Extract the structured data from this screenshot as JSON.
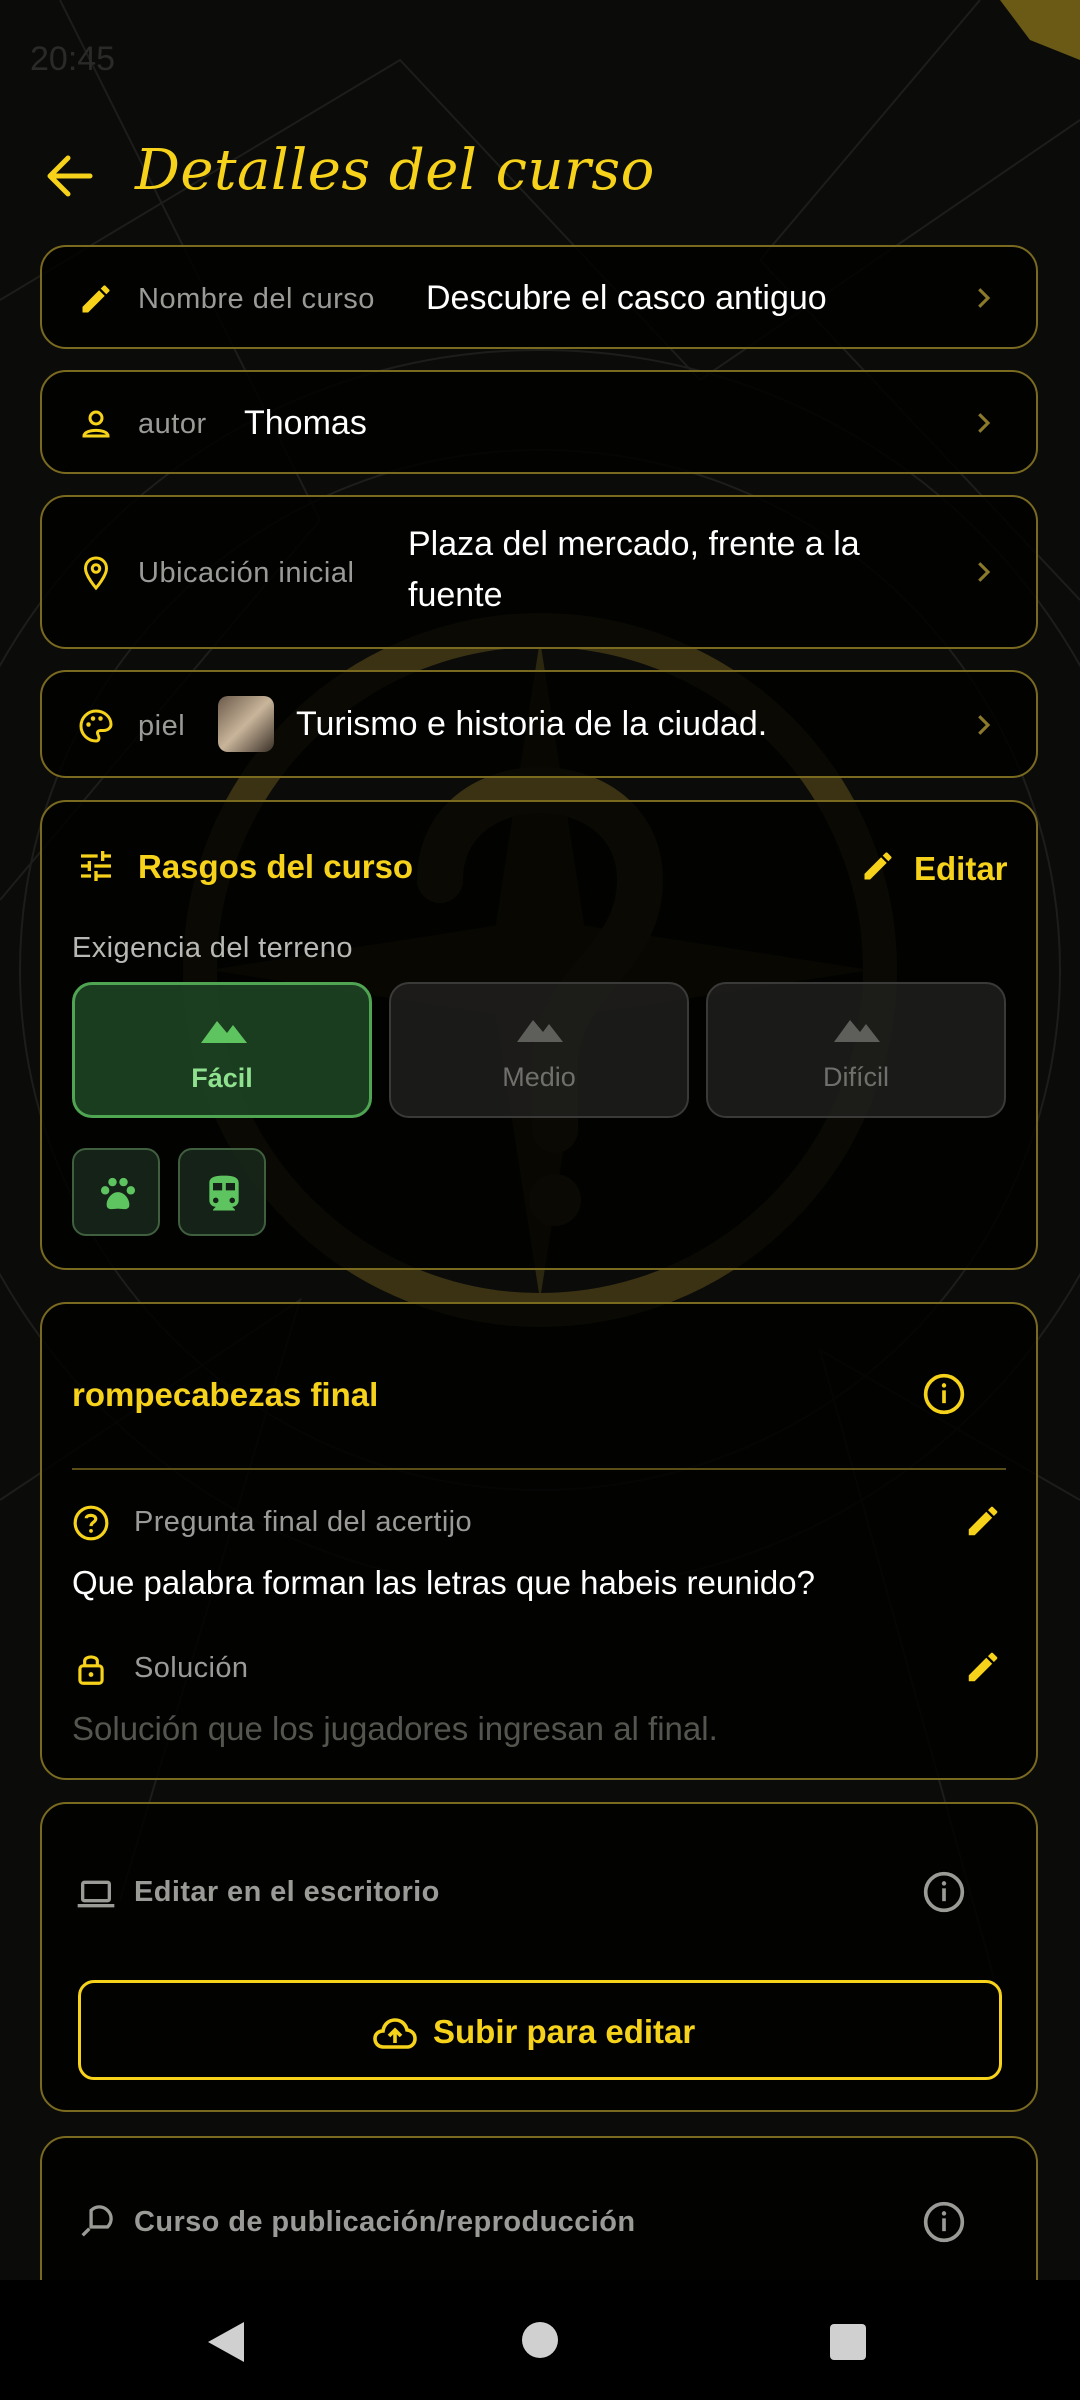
{
  "status_bar": {
    "time": "20:45"
  },
  "header": {
    "title": "Detalles del curso"
  },
  "rows": {
    "name": {
      "label": "Nombre del curso",
      "value": "Descubre el casco antiguo"
    },
    "author": {
      "label": "autor",
      "value": "Thomas"
    },
    "location": {
      "label": "Ubicación inicial",
      "value_line1": "Plaza del mercado, frente a la",
      "value_line2": "fuente"
    },
    "skin": {
      "label": "piel",
      "value": "Turismo e historia de la ciudad."
    }
  },
  "traits": {
    "title": "Rasgos del curso",
    "edit_label": "Editar",
    "terrain_label": "Exigencia del terreno",
    "difficulty_options": [
      "Fácil",
      "Medio",
      "Difícil"
    ],
    "selected_difficulty": "Fácil",
    "tags": [
      "paw-icon",
      "train-icon"
    ]
  },
  "puzzle": {
    "title": "rompecabezas final",
    "question_label": "Pregunta final del acertijo",
    "question": "Que palabra forman las letras que habeis reunido?",
    "solution_label": "Solución",
    "solution_placeholder": "Solución que los jugadores ingresan al final."
  },
  "desktop": {
    "label": "Editar en el escritorio",
    "upload_label": "Subir para editar"
  },
  "publish": {
    "label": "Curso de publicación/reproducción"
  },
  "colors": {
    "accent": "#f6d21b",
    "border": "#7a6a20",
    "success": "#4fa552",
    "background": "#0b0b0a"
  }
}
